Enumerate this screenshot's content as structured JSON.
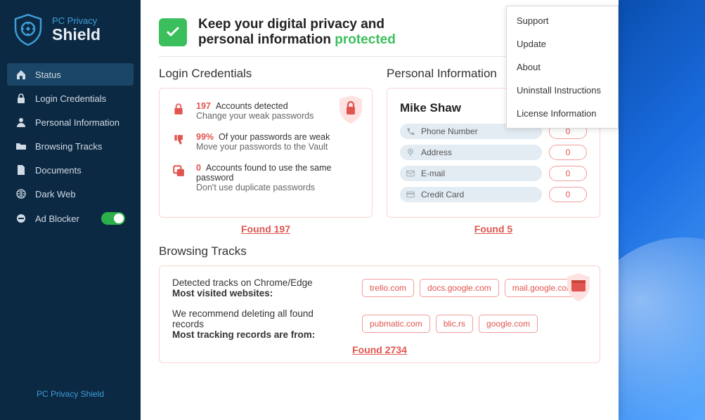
{
  "brand": {
    "line1": "PC Privacy",
    "line2": "Shield",
    "footer": "PC Privacy Shield"
  },
  "sidebar": {
    "items": [
      {
        "label": "Status"
      },
      {
        "label": "Login Credentials"
      },
      {
        "label": "Personal Information"
      },
      {
        "label": "Browsing Tracks"
      },
      {
        "label": "Documents"
      },
      {
        "label": "Dark Web"
      },
      {
        "label": "Ad Blocker"
      }
    ]
  },
  "header": {
    "line1": "Keep your digital privacy and",
    "line2a": "personal information ",
    "line2b": "protected"
  },
  "dropdown": {
    "items": [
      {
        "label": "Support"
      },
      {
        "label": "Update"
      },
      {
        "label": "About"
      },
      {
        "label": "Uninstall Instructions"
      },
      {
        "label": "License Information"
      }
    ]
  },
  "login": {
    "title": "Login Credentials",
    "rows": [
      {
        "count": "197",
        "headline": "Accounts detected",
        "sub": "Change your weak passwords"
      },
      {
        "count": "99%",
        "headline": "Of your passwords are weak",
        "sub": "Move your passwords to the Vault"
      },
      {
        "count": "0",
        "headline": "Accounts found to use the same password",
        "sub": "Don't use duplicate passwords"
      }
    ],
    "found": "Found 197"
  },
  "personal": {
    "title": "Personal Information",
    "name": "Mike Shaw",
    "rows": [
      {
        "label": "Phone Number",
        "count": "0"
      },
      {
        "label": "Address",
        "count": "0"
      },
      {
        "label": "E-mail",
        "count": "0"
      },
      {
        "label": "Credit Card",
        "count": "0"
      }
    ],
    "found": "Found 5"
  },
  "browsing": {
    "title": "Browsing Tracks",
    "block1": {
      "line1": "Detected tracks on Chrome/Edge",
      "line2": "Most visited websites:"
    },
    "block2": {
      "line1": "We recommend deleting all found records",
      "line2": "Most tracking records are from:"
    },
    "chips1": [
      "trello.com",
      "docs.google.com",
      "mail.google.com"
    ],
    "chips2": [
      "pubmatic.com",
      "blic.rs",
      "google.com"
    ],
    "found": "Found 2734"
  }
}
